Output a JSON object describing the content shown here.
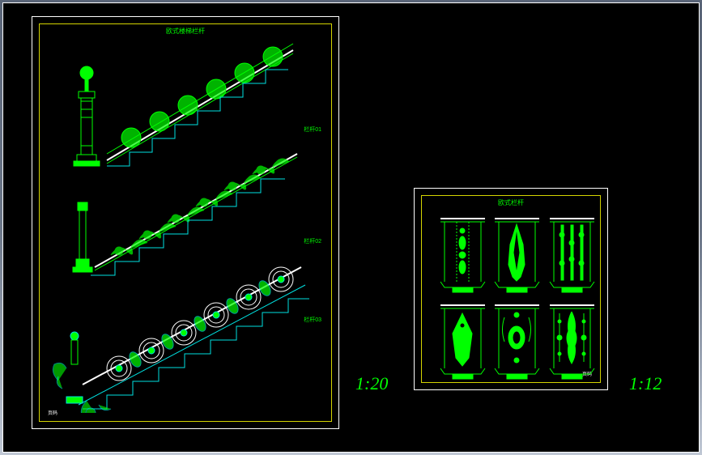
{
  "sheet_a": {
    "title": "欧式楼梯栏杆",
    "page_number": "页码",
    "rail_labels": [
      "栏杆01",
      "栏杆02",
      "栏杆03"
    ]
  },
  "sheet_b": {
    "title": "欧式栏杆",
    "page_number": "页码"
  },
  "scale_labels": {
    "a": "1:20",
    "b": "1:12"
  }
}
